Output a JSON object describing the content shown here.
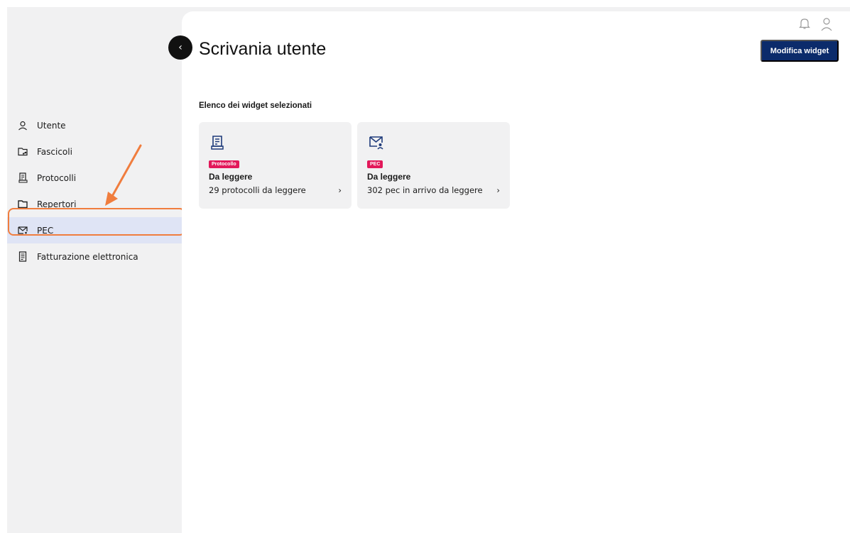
{
  "page": {
    "title": "Scrivania utente"
  },
  "header": {
    "edit_button": "Modifica widget"
  },
  "sidebar": {
    "items": [
      {
        "label": "Utente",
        "icon": "user-icon"
      },
      {
        "label": "Fascicoli",
        "icon": "folder-share-icon"
      },
      {
        "label": "Protocolli",
        "icon": "document-list-icon"
      },
      {
        "label": "Repertori",
        "icon": "folder-icon"
      },
      {
        "label": "PEC",
        "icon": "mail-user-icon",
        "active": true
      },
      {
        "label": "Fatturazione elettronica",
        "icon": "receipt-icon"
      }
    ]
  },
  "main": {
    "section_label": "Elenco dei widget selezionati",
    "cards": [
      {
        "badge": "Protocollo",
        "title": "Da leggere",
        "text": "29 protocolli da leggere",
        "chevron": "›",
        "icon": "document-list-icon"
      },
      {
        "badge": "PEC",
        "title": "Da leggere",
        "text": "302 pec in arrivo da leggere",
        "chevron": "›",
        "icon": "mail-user-icon"
      }
    ]
  },
  "colors": {
    "primary": "#0b2b6b",
    "badge": "#e2185a",
    "highlight": "#f07d3e",
    "active_bg": "#dfe4f5"
  }
}
